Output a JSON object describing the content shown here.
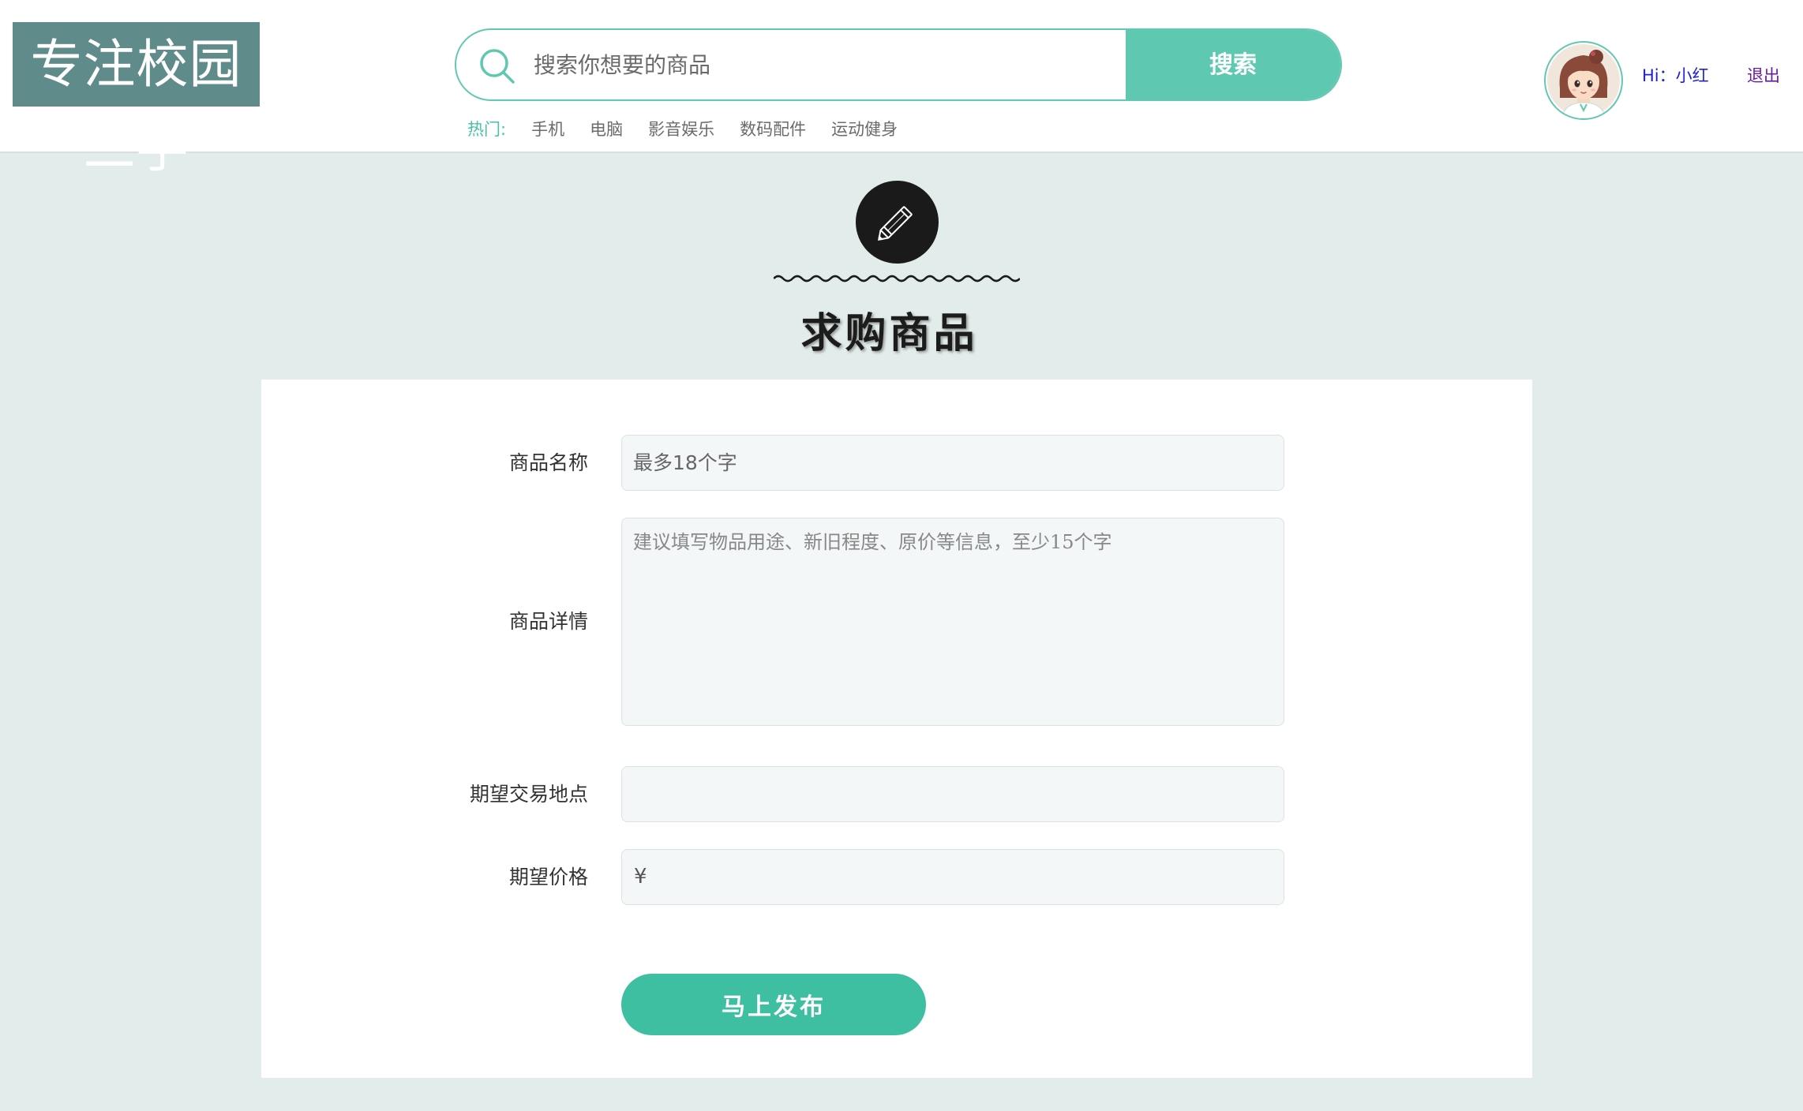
{
  "header": {
    "logo_text": "专注校园二手",
    "search": {
      "placeholder": "搜索你想要的商品",
      "button_label": "搜索"
    },
    "hot": {
      "label": "热门:",
      "items": [
        "手机",
        "电脑",
        "影音娱乐",
        "数码配件",
        "运动健身"
      ]
    },
    "user": {
      "greeting": "Hi：小红",
      "logout_label": "退出"
    }
  },
  "page": {
    "title": "求购商品"
  },
  "form": {
    "name": {
      "label": "商品名称",
      "placeholder": "最多18个字"
    },
    "detail": {
      "label": "商品详情",
      "placeholder": "建议填写物品用途、新旧程度、原价等信息，至少15个字"
    },
    "location": {
      "label": "期望交易地点",
      "placeholder": ""
    },
    "price": {
      "label": "期望价格",
      "currency_symbol": "¥"
    },
    "submit_label": "马上发布"
  },
  "colors": {
    "accent": "#5fc8b1",
    "button": "#3ebfa1",
    "page_bg": "#e2ecea",
    "logo_bg": "#5f8b8b"
  }
}
